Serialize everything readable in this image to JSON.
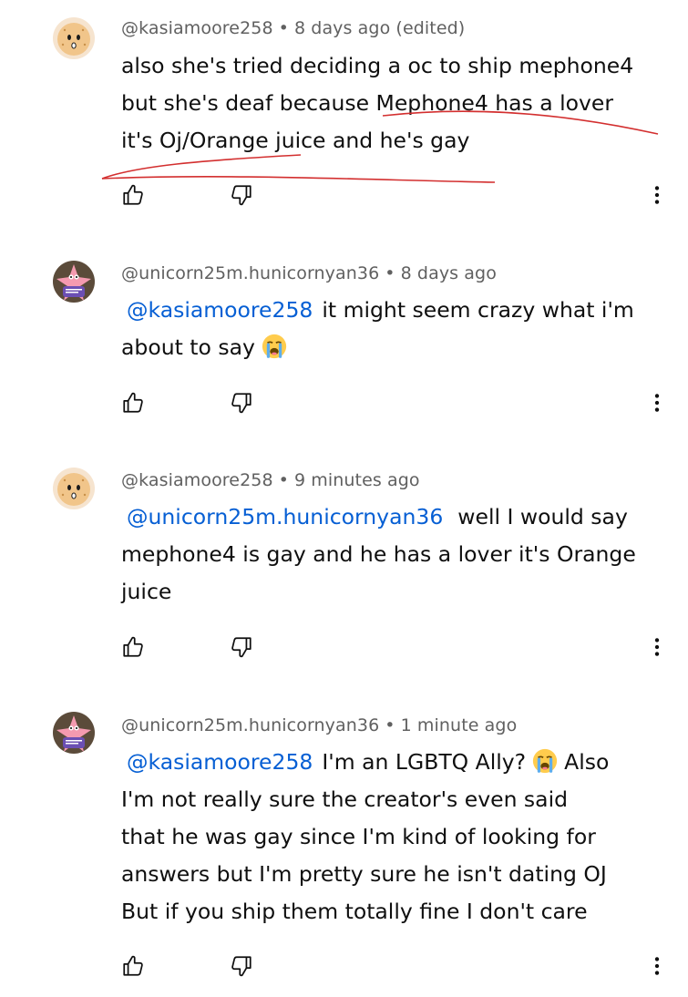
{
  "comments": [
    {
      "author": "@kasiamoore258",
      "time": "8 days ago (edited)",
      "avatar": "cracker-face-avatar",
      "mention": "",
      "lines": [
        "also she's tried deciding a oc to ship mephone4",
        "but she's deaf because Mephone4 has a lover",
        "it's Oj/Orange juice and he's gay"
      ]
    },
    {
      "author": "@unicorn25m.hunicornyan36",
      "time": "8 days ago",
      "avatar": "patrick-star-avatar",
      "mention": "@kasiamoore258",
      "lines": [
        "it might seem crazy what i'm",
        "about to say"
      ],
      "emoji": "loudly-crying-face"
    },
    {
      "author": "@kasiamoore258",
      "time": "9 minutes ago",
      "avatar": "cracker-face-avatar",
      "mention": "@unicorn25m.hunicornyan36",
      "lines": [
        "well I would say",
        "mephone4 is gay and he has a lover it's Orange",
        "juice"
      ]
    },
    {
      "author": "@unicorn25m.hunicornyan36",
      "time": "1 minute ago",
      "avatar": "patrick-star-avatar",
      "mention": "@kasiamoore258",
      "lines": [
        "I'm an LGBTQ Ally?",
        "Also",
        "I'm not really sure the creator's even said",
        "that he was gay since I'm kind of looking for",
        "answers but I'm pretty sure he isn't dating OJ",
        "But if you ship them totally fine I don't care"
      ],
      "emoji": "loudly-crying-face"
    }
  ],
  "separator": "•",
  "icons": {
    "like": "thumbs-up-icon",
    "dislike": "thumbs-down-icon",
    "more": "more-vert-icon"
  },
  "colors": {
    "author": "#606060",
    "text": "#0f0f0f",
    "mention": "#065fd4",
    "annotation": "#d32f2f"
  }
}
